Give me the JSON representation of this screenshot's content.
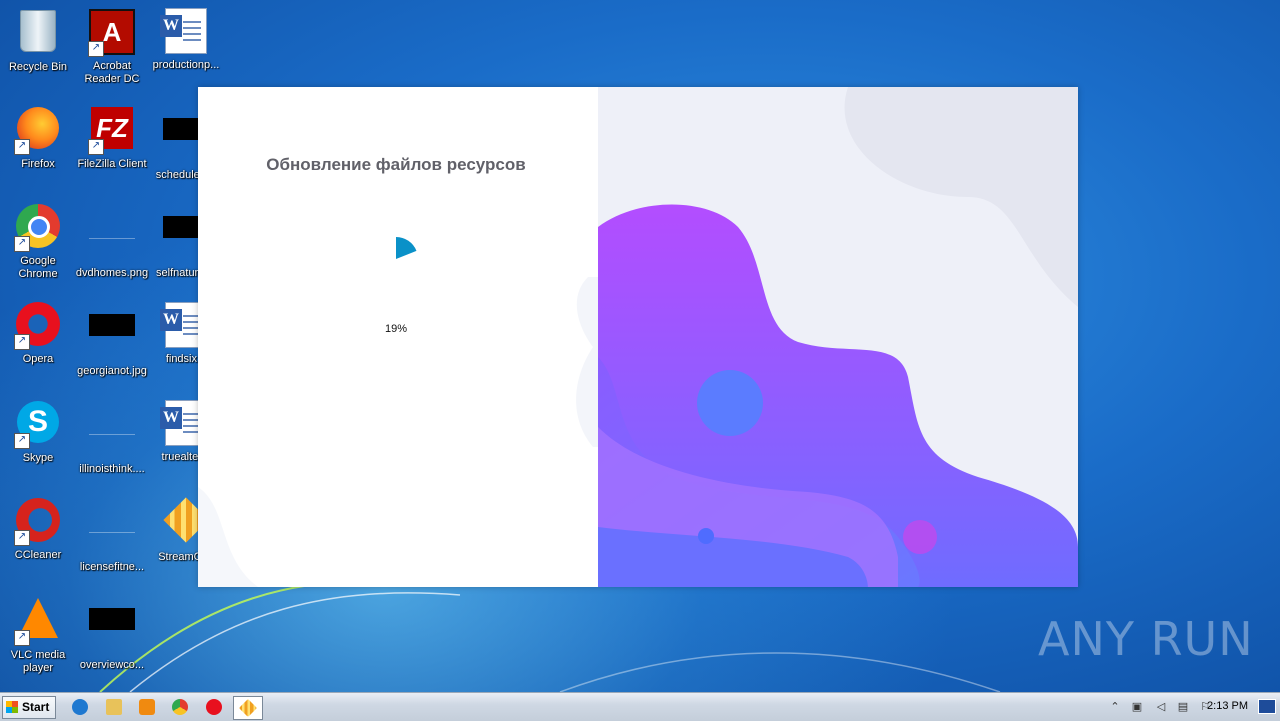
{
  "desktop": {
    "icons": [
      {
        "label": "Recycle Bin",
        "icon": "recycle-bin-icon"
      },
      {
        "label": "Acrobat Reader DC",
        "icon": "acrobat-icon"
      },
      {
        "label": "productionp...",
        "icon": "word-document-icon"
      },
      {
        "label": "Firefox",
        "icon": "firefox-icon"
      },
      {
        "label": "FileZilla Client",
        "icon": "filezilla-icon"
      },
      {
        "label": "schedulew...",
        "icon": "image-file-icon"
      },
      {
        "label": "Google Chrome",
        "icon": "chrome-icon"
      },
      {
        "label": "dvdhomes.png",
        "icon": "image-file-icon"
      },
      {
        "label": "selfnatural...",
        "icon": "image-file-icon"
      },
      {
        "label": "Opera",
        "icon": "opera-icon"
      },
      {
        "label": "georgianot.jpg",
        "icon": "image-file-icon"
      },
      {
        "label": "findsix...",
        "icon": "word-document-icon"
      },
      {
        "label": "Skype",
        "icon": "skype-icon"
      },
      {
        "label": "illinoisthink....",
        "icon": "image-file-icon"
      },
      {
        "label": "truealter...",
        "icon": "word-document-icon"
      },
      {
        "label": "CCleaner",
        "icon": "ccleaner-icon"
      },
      {
        "label": "licensefitne...",
        "icon": "image-file-icon"
      },
      {
        "label": "StreamCr...",
        "icon": "streamcraft-icon"
      },
      {
        "label": "VLC media player",
        "icon": "vlc-icon"
      },
      {
        "label": "overviewco...",
        "icon": "image-file-icon"
      }
    ]
  },
  "installer": {
    "title": "Обновление файлов ресурсов",
    "percent": "19%",
    "progress": 0.19,
    "accent": "#0a91c8"
  },
  "taskbar": {
    "start_label": "Start",
    "apps": [
      "internet-explorer-icon",
      "explorer-icon",
      "media-player-icon",
      "chrome-icon",
      "opera-icon",
      "streamcraft-icon"
    ],
    "clock": "2:13 PM"
  },
  "watermark": "ANY RUN"
}
